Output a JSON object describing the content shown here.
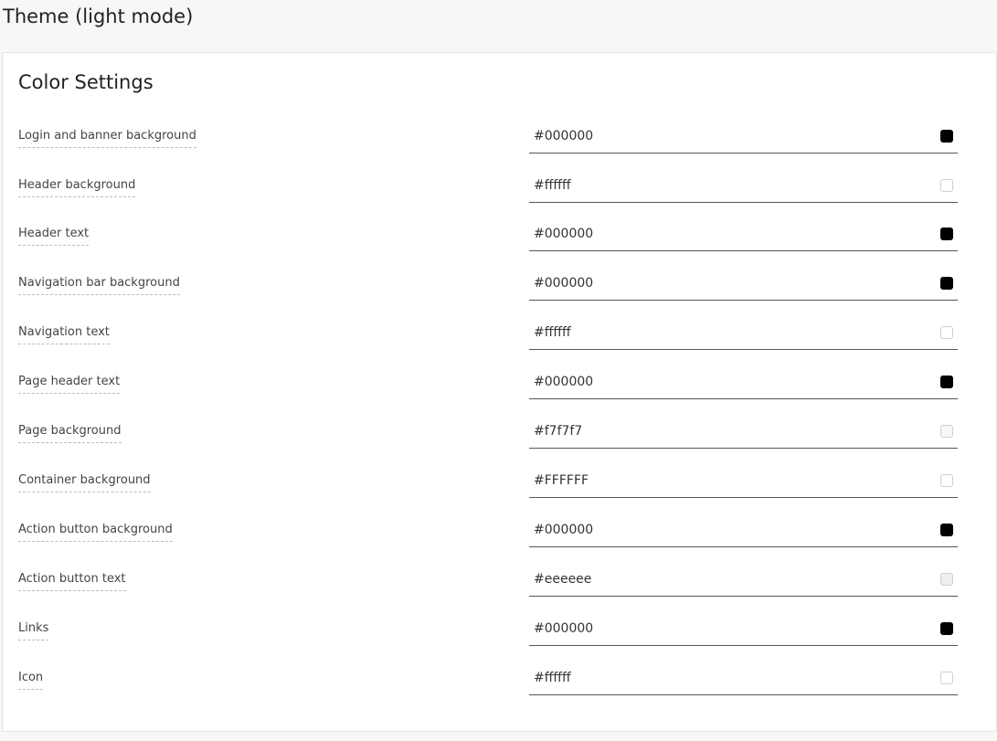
{
  "page": {
    "title": "Theme (light mode)"
  },
  "card": {
    "title": "Color Settings"
  },
  "settings": [
    {
      "label": "Login and banner background",
      "value": "#000000",
      "swatch": "#000000"
    },
    {
      "label": "Header background",
      "value": "#ffffff",
      "swatch": "#ffffff"
    },
    {
      "label": "Header text",
      "value": "#000000",
      "swatch": "#000000"
    },
    {
      "label": "Navigation bar background",
      "value": "#000000",
      "swatch": "#000000"
    },
    {
      "label": "Navigation text",
      "value": "#ffffff",
      "swatch": "#ffffff"
    },
    {
      "label": "Page header text",
      "value": "#000000",
      "swatch": "#000000"
    },
    {
      "label": "Page background",
      "value": "#f7f7f7",
      "swatch": "#f7f7f7"
    },
    {
      "label": "Container background",
      "value": "#FFFFFF",
      "swatch": "#FFFFFF"
    },
    {
      "label": "Action button background",
      "value": "#000000",
      "swatch": "#000000"
    },
    {
      "label": "Action button text",
      "value": "#eeeeee",
      "swatch": "#eeeeee"
    },
    {
      "label": "Links",
      "value": "#000000",
      "swatch": "#000000"
    },
    {
      "label": "Icon",
      "value": "#ffffff",
      "swatch": "#ffffff"
    }
  ],
  "colors": {
    "page_background": "#f7f7f7",
    "card_background": "#ffffff",
    "field_underline": "#555555",
    "label_dash": "#bdbdbd"
  }
}
